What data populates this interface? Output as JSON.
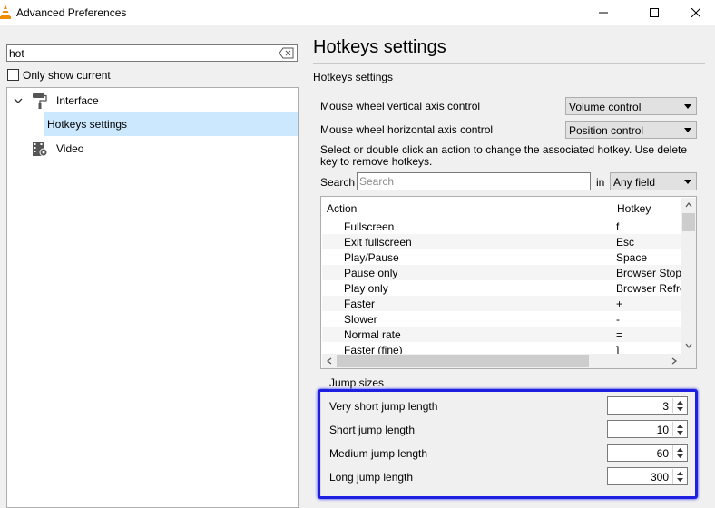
{
  "window": {
    "title": "Advanced Preferences"
  },
  "sidebar": {
    "search_value": "hot",
    "only_show_current_label": "Only show current",
    "only_show_current_checked": false,
    "tree": [
      {
        "label": "Interface",
        "icon": "paint-roller-icon",
        "expanded": true
      },
      {
        "label": "Hotkeys settings",
        "selected": true
      },
      {
        "label": "Video",
        "icon": "film-gear-icon"
      }
    ]
  },
  "main": {
    "title": "Hotkeys settings",
    "section_heading": "Hotkeys settings",
    "vertical_axis_label": "Mouse wheel vertical axis control",
    "vertical_axis_value": "Volume control",
    "horizontal_axis_label": "Mouse wheel horizontal axis control",
    "horizontal_axis_value": "Position control",
    "info": "Select or double click an action to change the associated hotkey. Use delete key to remove hotkeys.",
    "search_label": "Search",
    "search_placeholder": "Search",
    "in_label": "in",
    "field_value": "Any field",
    "table": {
      "columns": [
        "Action",
        "Hotkey"
      ],
      "rows": [
        {
          "action": "Fullscreen",
          "hotkey": "f"
        },
        {
          "action": "Exit fullscreen",
          "hotkey": "Esc"
        },
        {
          "action": "Play/Pause",
          "hotkey": "Space"
        },
        {
          "action": "Pause only",
          "hotkey": "Browser Stop"
        },
        {
          "action": "Play only",
          "hotkey": "Browser Refre"
        },
        {
          "action": "Faster",
          "hotkey": "+"
        },
        {
          "action": "Slower",
          "hotkey": "-"
        },
        {
          "action": "Normal rate",
          "hotkey": "="
        },
        {
          "action": "Faster (fine)",
          "hotkey": "]"
        }
      ]
    },
    "jump_sizes": {
      "title": "Jump sizes",
      "items": [
        {
          "label": "Very short jump length",
          "value": "3"
        },
        {
          "label": "Short jump length",
          "value": "10"
        },
        {
          "label": "Medium jump length",
          "value": "60"
        },
        {
          "label": "Long jump length",
          "value": "300"
        }
      ]
    }
  },
  "colors": {
    "selection": "#cce8ff",
    "highlight_border": "#1f1fe0",
    "vlc_orange": "#f08c00"
  }
}
